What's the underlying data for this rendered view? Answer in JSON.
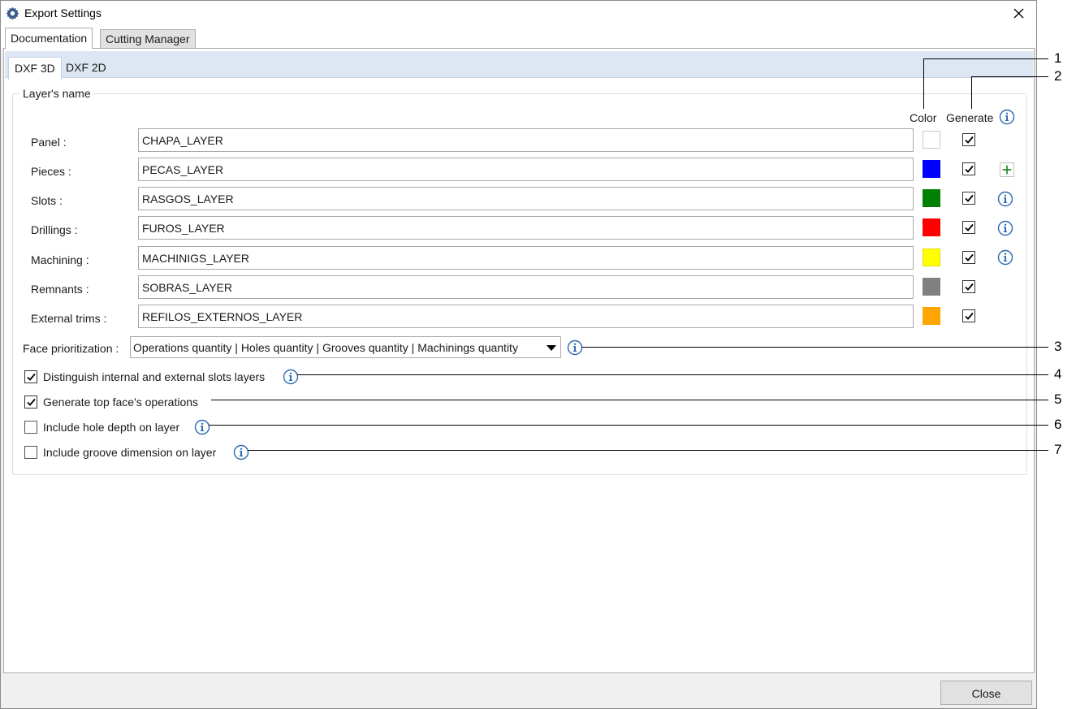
{
  "window": {
    "title": "Export Settings"
  },
  "outer_tabs": [
    {
      "label": "Documentation",
      "active": true
    },
    {
      "label": "Cutting Manager",
      "active": false
    }
  ],
  "inner_tabs": [
    {
      "label": "DXF 3D",
      "active": true
    },
    {
      "label": "DXF 2D",
      "active": false
    }
  ],
  "group": {
    "legend": "Layer's name"
  },
  "headers": {
    "color": "Color",
    "generate": "Generate"
  },
  "layers": [
    {
      "label": "Panel :",
      "value": "CHAPA_LAYER",
      "color": "#ffffff",
      "generate": true,
      "extra": "none"
    },
    {
      "label": "Pieces :",
      "value": "PECAS_LAYER",
      "color": "#0000ff",
      "generate": true,
      "extra": "plus-icon"
    },
    {
      "label": "Slots :",
      "value": "RASGOS_LAYER",
      "color": "#008000",
      "generate": true,
      "extra": "info-icon"
    },
    {
      "label": "Drillings :",
      "value": "FUROS_LAYER",
      "color": "#ff0000",
      "generate": true,
      "extra": "info-icon"
    },
    {
      "label": "Machining :",
      "value": "MACHINIGS_LAYER",
      "color": "#ffff00",
      "generate": true,
      "extra": "info-icon"
    },
    {
      "label": "Remnants :",
      "value": "SOBRAS_LAYER",
      "color": "#808080",
      "generate": true,
      "extra": "none"
    },
    {
      "label": "External trims :",
      "value": "REFILOS_EXTERNOS_LAYER",
      "color": "#ffa500",
      "generate": true,
      "extra": "none"
    }
  ],
  "face_prioritization": {
    "label": "Face prioritization :",
    "value": "Operations quantity | Holes quantity | Grooves quantity | Machinings quantity"
  },
  "options": [
    {
      "label": "Distinguish internal and external slots layers",
      "checked": true,
      "info": true
    },
    {
      "label": "Generate top face's operations",
      "checked": true,
      "info": false
    },
    {
      "label": "Include hole depth on layer",
      "checked": false,
      "info": true
    },
    {
      "label": "Include groove dimension on layer",
      "checked": false,
      "info": true
    }
  ],
  "buttons": {
    "close": "Close"
  },
  "callouts": [
    "1",
    "2",
    "3",
    "4",
    "5",
    "6",
    "7"
  ],
  "colors": {
    "info_blue": "#2e6bb0",
    "plus_green": "#2e8b2e",
    "tab_strip": "#dde7f3"
  }
}
